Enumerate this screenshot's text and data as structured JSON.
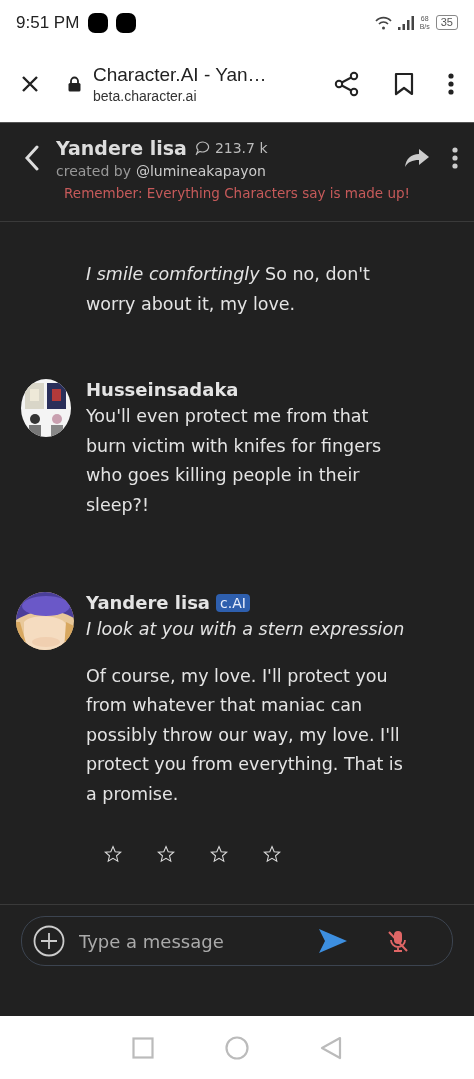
{
  "status_bar": {
    "time": "9:51 PM",
    "net_speed_value": "68",
    "net_speed_unit": "B/s",
    "battery": "35"
  },
  "browser": {
    "title": "Character.AI - Yan…",
    "url": "beta.character.ai"
  },
  "chat_header": {
    "name": "Yandere lisa",
    "chat_count": "213.7 k",
    "creator_label": "created by",
    "creator": "@lumineakapayon",
    "disclaimer": "Remember: Everything Characters say is made up!"
  },
  "messages": [
    {
      "kind": "continuation",
      "paragraphs": [
        "*I smile comfortingly* So no, don't worry about it, my love."
      ]
    },
    {
      "kind": "user",
      "author": "Husseinsadaka",
      "avatar": {
        "kind": "picture"
      },
      "paragraphs": [
        "You'll even protect me from that burn victim with knifes for fingers who goes killing people in their sleep?!"
      ]
    },
    {
      "kind": "character",
      "author": "Yandere lisa",
      "badge": "c.AI",
      "avatar": {
        "kind": "picture"
      },
      "paragraphs": [
        "*I look at you with a stern expression*",
        "Of course, my love. I'll protect you from whatever that maniac can possibly throw our way, my love. I'll protect you from everything. That is a promise."
      ],
      "stars": 0
    }
  ],
  "composer": {
    "placeholder": "Type a message",
    "mic_muted": true
  }
}
